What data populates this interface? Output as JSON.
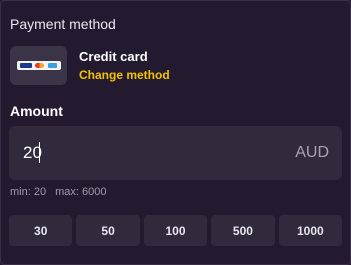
{
  "payment": {
    "section_title": "Payment method",
    "method_name": "Credit card",
    "change_link": "Change method",
    "card_logos": [
      "VISA",
      "MC",
      "AMEX"
    ]
  },
  "amount": {
    "label": "Amount",
    "value": "20",
    "currency": "AUD",
    "min_text": "min: 20",
    "max_text": "max: 6000"
  },
  "presets": [
    "30",
    "50",
    "100",
    "500",
    "1000"
  ],
  "colors": {
    "background": "#251a31",
    "field": "#32293d",
    "accent_link": "#f2c200",
    "muted_text": "#a19aab"
  }
}
